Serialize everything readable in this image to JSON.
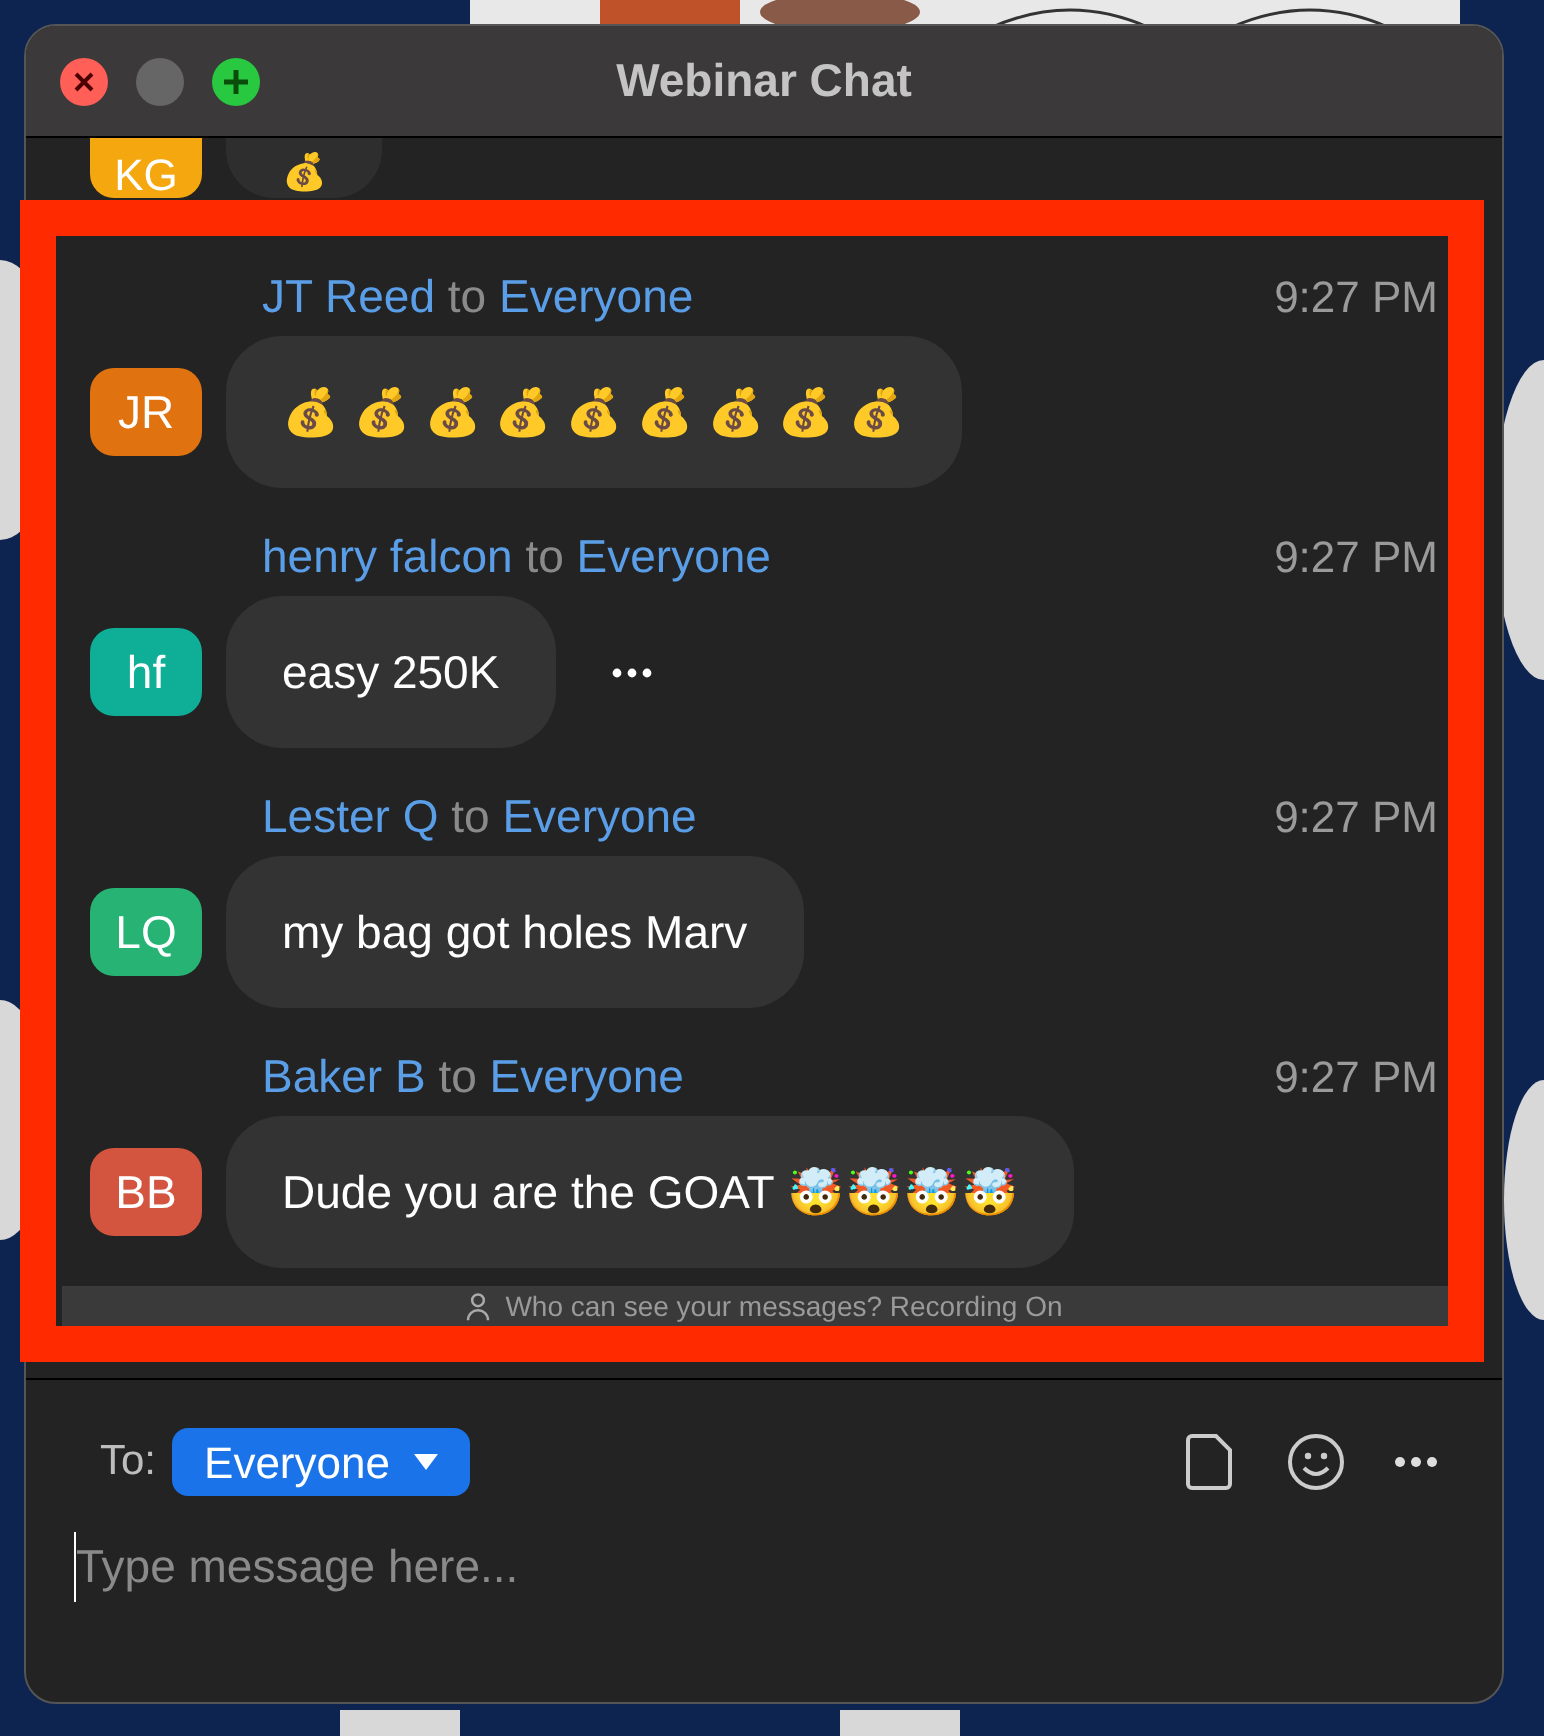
{
  "window": {
    "title": "Webinar Chat"
  },
  "messages": [
    {
      "kind": "partial",
      "initials": "KG",
      "color": "#f5a70f",
      "text": "💰"
    },
    {
      "kind": "message",
      "initials": "JR",
      "color": "#e0720f",
      "sender": "JT Reed",
      "to": "to",
      "recipient": "Everyone",
      "time": "9:27 PM",
      "text": "💰 💰 💰 💰 💰 💰 💰 💰 💰",
      "more": false
    },
    {
      "kind": "message",
      "initials": "hf",
      "color": "#0fae97",
      "sender": "henry falcon",
      "to": "to",
      "recipient": "Everyone",
      "time": "9:27 PM",
      "text": "easy 250K",
      "more": true
    },
    {
      "kind": "message",
      "initials": "LQ",
      "color": "#27b374",
      "sender": "Lester Q",
      "to": "to",
      "recipient": "Everyone",
      "time": "9:27 PM",
      "text": "my bag got holes Marv",
      "more": false
    },
    {
      "kind": "message",
      "initials": "BB",
      "color": "#d4553f",
      "sender": "Baker B",
      "to": "to",
      "recipient": "Everyone",
      "time": "9:27 PM",
      "text": "Dude you are the GOAT 🤯🤯🤯🤯",
      "more": false
    }
  ],
  "notice": "Who can see your messages? Recording On",
  "composer": {
    "to_label": "To:",
    "recipient": "Everyone",
    "placeholder": "Type message here..."
  }
}
